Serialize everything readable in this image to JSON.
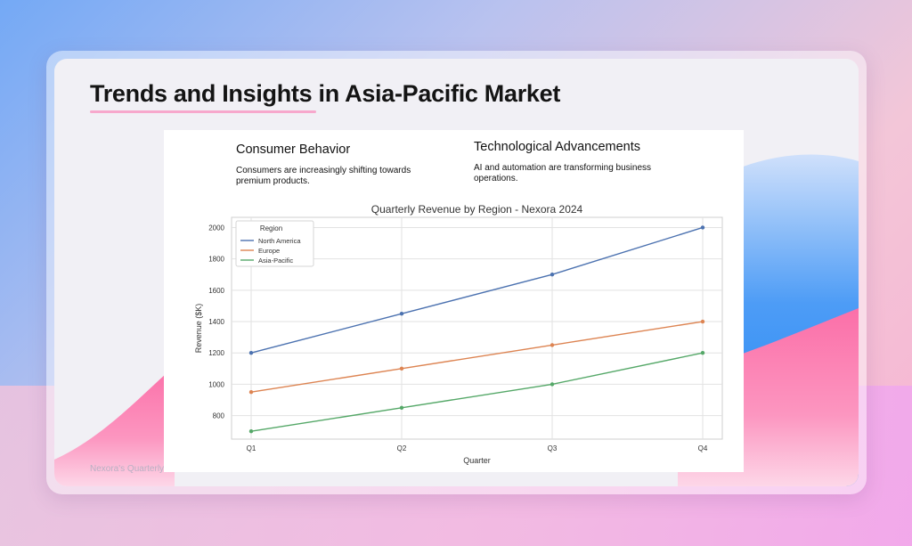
{
  "slide": {
    "title": "Trends and Insights in Asia-Pacific Market",
    "footer": "Nexora's Quarterly"
  },
  "insights": [
    {
      "heading": "Consumer Behavior",
      "text": "Consumers are increasingly shifting towards premium products."
    },
    {
      "heading": "Technological Advancements",
      "text": "AI and automation are transforming business operations."
    }
  ],
  "colors": {
    "accent_underline": "#f7a8cc",
    "north_america": "#4c72b0",
    "europe": "#dd8452",
    "asia_pacific": "#55a868"
  },
  "chart_data": {
    "type": "line",
    "title": "Quarterly Revenue by Region - Nexora 2024",
    "xlabel": "Quarter",
    "ylabel": "Revenue ($K)",
    "categories": [
      "Q1",
      "Q2",
      "Q3",
      "Q4"
    ],
    "yticks": [
      800,
      1000,
      1200,
      1400,
      1600,
      1800,
      2000
    ],
    "ylim": [
      650,
      2065
    ],
    "grid": true,
    "legend": {
      "title": "Region",
      "placement": "top-left"
    },
    "series": [
      {
        "name": "North America",
        "color": "#4c72b0",
        "values": [
          1200,
          1450,
          1700,
          2000
        ]
      },
      {
        "name": "Europe",
        "color": "#dd8452",
        "values": [
          950,
          1100,
          1250,
          1400
        ]
      },
      {
        "name": "Asia-Pacific",
        "color": "#55a868",
        "values": [
          700,
          850,
          1000,
          1200
        ]
      }
    ]
  }
}
